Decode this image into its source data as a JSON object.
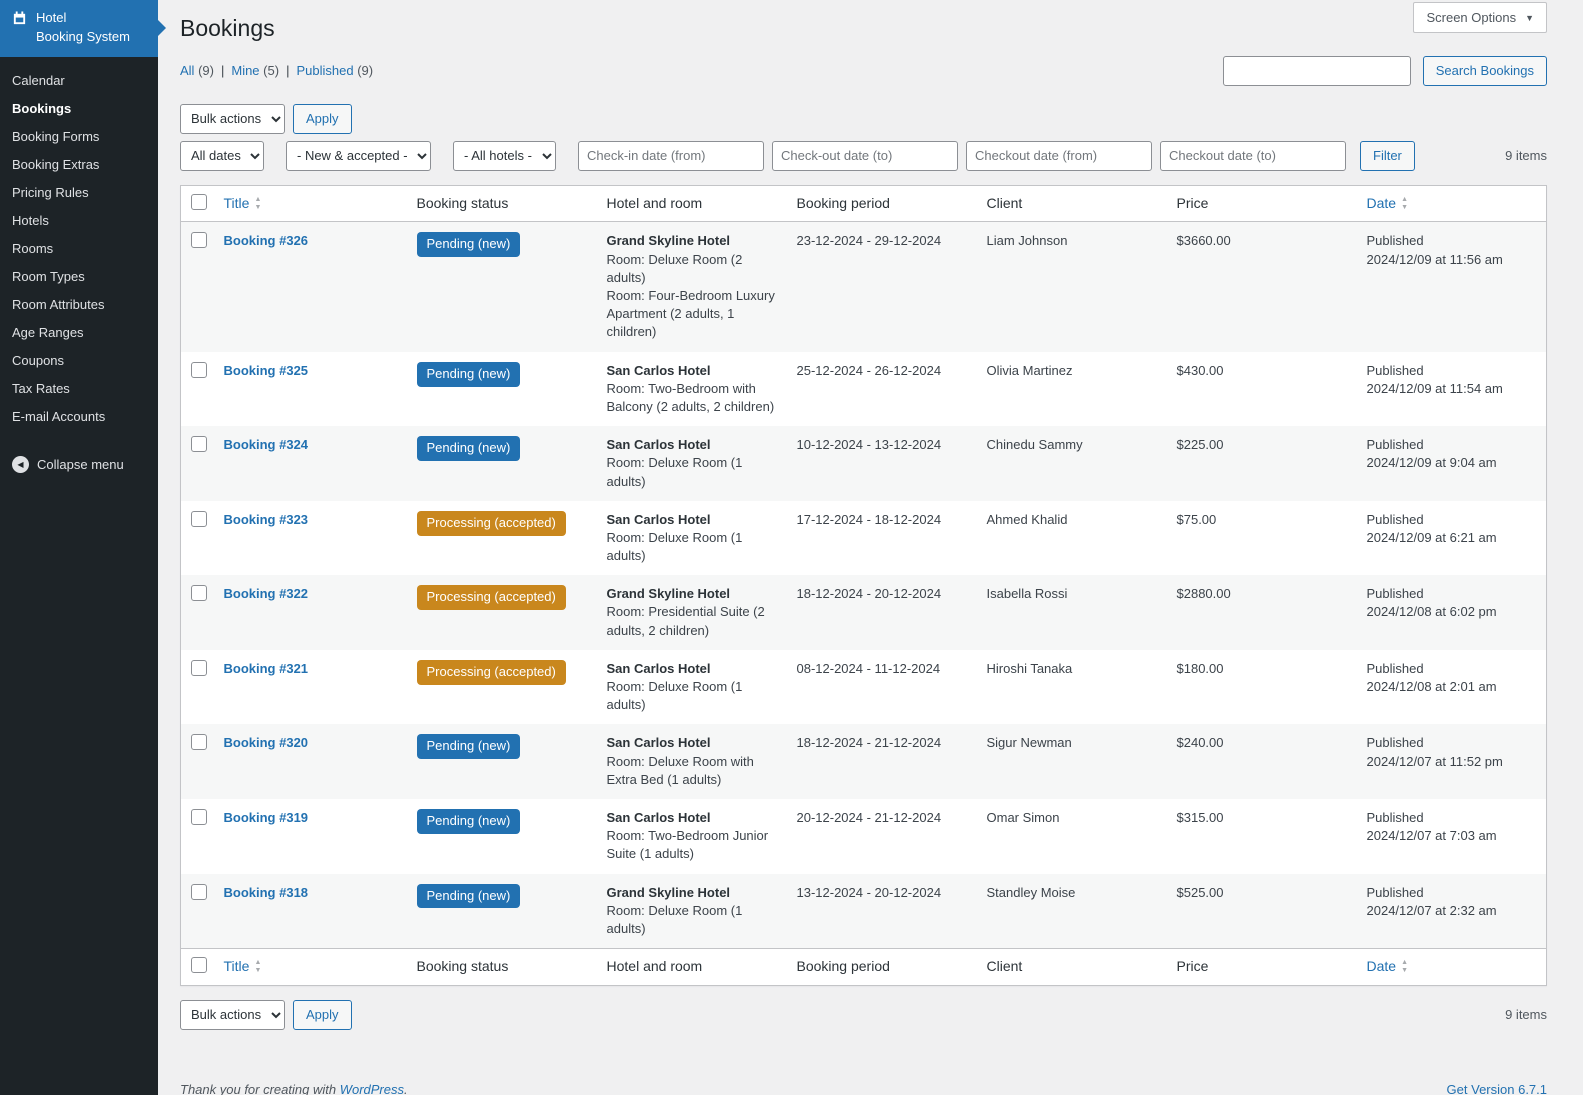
{
  "colors": {
    "accent": "#2271b1",
    "pending_badge": "#2271b1",
    "processing_badge": "#c9871d",
    "sidebar_bg": "#1d2327",
    "brand_bg": "#2271b1",
    "page_bg": "#f0f0f1"
  },
  "icons": {
    "calendar": "calendar-icon",
    "caret_down": "▼",
    "sort_asc": "▲",
    "sort_desc": "▼",
    "collapse_arrow": "◀"
  },
  "sidebar": {
    "brand": {
      "line1": "Hotel",
      "line2": "Booking System"
    },
    "items": [
      {
        "label": "Calendar",
        "active": false
      },
      {
        "label": "Bookings",
        "active": true
      },
      {
        "label": "Booking Forms",
        "active": false
      },
      {
        "label": "Booking Extras",
        "active": false
      },
      {
        "label": "Pricing Rules",
        "active": false
      },
      {
        "label": "Hotels",
        "active": false
      },
      {
        "label": "Rooms",
        "active": false
      },
      {
        "label": "Room Types",
        "active": false
      },
      {
        "label": "Room Attributes",
        "active": false
      },
      {
        "label": "Age Ranges",
        "active": false
      },
      {
        "label": "Coupons",
        "active": false
      },
      {
        "label": "Tax Rates",
        "active": false
      },
      {
        "label": "E-mail Accounts",
        "active": false
      }
    ],
    "collapse_label": "Collapse menu"
  },
  "header": {
    "page_title": "Bookings",
    "screen_options_label": "Screen Options"
  },
  "subsubsub": {
    "separator": "|",
    "all": {
      "label": "All",
      "count": "(9)"
    },
    "mine": {
      "label": "Mine",
      "count": "(5)"
    },
    "published": {
      "label": "Published",
      "count": "(9)"
    }
  },
  "search": {
    "value": "",
    "button_label": "Search Bookings"
  },
  "bulk": {
    "selected": "Bulk actions",
    "apply_label": "Apply"
  },
  "filters": {
    "dates_selected": "All dates",
    "status_selected": "- New & accepted -",
    "hotels_selected": "- All hotels -",
    "checkin_from_placeholder": "Check-in date (from)",
    "checkout_to_placeholder": "Check-out date (to)",
    "checkout_from_placeholder": "Checkout date (from)",
    "checkout_to2_placeholder": "Checkout date (to)",
    "filter_button_label": "Filter"
  },
  "table": {
    "items_count": "9 items",
    "columns": {
      "title": "Title",
      "status": "Booking status",
      "hotel": "Hotel and room",
      "period": "Booking period",
      "client": "Client",
      "price": "Price",
      "date": "Date"
    },
    "rows": [
      {
        "title": "Booking #326",
        "status": "Pending (new)",
        "status_type": "pending",
        "hotel": "Grand Skyline Hotel",
        "rooms": [
          "Room: Deluxe Room (2 adults)",
          "Room: Four-Bedroom Luxury Apartment (2 adults, 1 children)"
        ],
        "period": "23-12-2024 - 29-12-2024",
        "client": "Liam Johnson",
        "price": "$3660.00",
        "published": "Published",
        "date": "2024/12/09 at 11:56 am"
      },
      {
        "title": "Booking #325",
        "status": "Pending (new)",
        "status_type": "pending",
        "hotel": "San Carlos Hotel",
        "rooms": [
          "Room: Two-Bedroom with Balcony (2 adults, 2 children)"
        ],
        "period": "25-12-2024 - 26-12-2024",
        "client": "Olivia Martinez",
        "price": "$430.00",
        "published": "Published",
        "date": "2024/12/09 at 11:54 am"
      },
      {
        "title": "Booking #324",
        "status": "Pending (new)",
        "status_type": "pending",
        "hotel": "San Carlos Hotel",
        "rooms": [
          "Room: Deluxe Room (1 adults)"
        ],
        "period": "10-12-2024 - 13-12-2024",
        "client": "Chinedu Sammy",
        "price": "$225.00",
        "published": "Published",
        "date": "2024/12/09 at 9:04 am"
      },
      {
        "title": "Booking #323",
        "status": "Processing (accepted)",
        "status_type": "processing",
        "hotel": "San Carlos Hotel",
        "rooms": [
          "Room: Deluxe Room (1 adults)"
        ],
        "period": "17-12-2024 - 18-12-2024",
        "client": "Ahmed Khalid",
        "price": "$75.00",
        "published": "Published",
        "date": "2024/12/09 at 6:21 am"
      },
      {
        "title": "Booking #322",
        "status": "Processing (accepted)",
        "status_type": "processing",
        "hotel": "Grand Skyline Hotel",
        "rooms": [
          "Room: Presidential Suite (2 adults, 2 children)"
        ],
        "period": "18-12-2024 - 20-12-2024",
        "client": "Isabella Rossi",
        "price": "$2880.00",
        "published": "Published",
        "date": "2024/12/08 at 6:02 pm"
      },
      {
        "title": "Booking #321",
        "status": "Processing (accepted)",
        "status_type": "processing",
        "hotel": "San Carlos Hotel",
        "rooms": [
          "Room: Deluxe Room (1 adults)"
        ],
        "period": "08-12-2024 - 11-12-2024",
        "client": "Hiroshi Tanaka",
        "price": "$180.00",
        "published": "Published",
        "date": "2024/12/08 at 2:01 am"
      },
      {
        "title": "Booking #320",
        "status": "Pending (new)",
        "status_type": "pending",
        "hotel": "San Carlos Hotel",
        "rooms": [
          "Room: Deluxe Room with Extra Bed (1 adults)"
        ],
        "period": "18-12-2024 - 21-12-2024",
        "client": "Sigur Newman",
        "price": "$240.00",
        "published": "Published",
        "date": "2024/12/07 at 11:52 pm"
      },
      {
        "title": "Booking #319",
        "status": "Pending (new)",
        "status_type": "pending",
        "hotel": "San Carlos Hotel",
        "rooms": [
          "Room: Two-Bedroom Junior Suite (1 adults)"
        ],
        "period": "20-12-2024 - 21-12-2024",
        "client": "Omar Simon",
        "price": "$315.00",
        "published": "Published",
        "date": "2024/12/07 at 7:03 am"
      },
      {
        "title": "Booking #318",
        "status": "Pending (new)",
        "status_type": "pending",
        "hotel": "Grand Skyline Hotel",
        "rooms": [
          "Room: Deluxe Room (1 adults)"
        ],
        "period": "13-12-2024 - 20-12-2024",
        "client": "Standley Moise",
        "price": "$525.00",
        "published": "Published",
        "date": "2024/12/07 at 2:32 am"
      }
    ]
  },
  "footer": {
    "thanks_prefix": "Thank you for creating with",
    "wordpress_link_label": "WordPress",
    "thanks_suffix": ".",
    "version_link_label": "Get Version 6.7.1"
  }
}
